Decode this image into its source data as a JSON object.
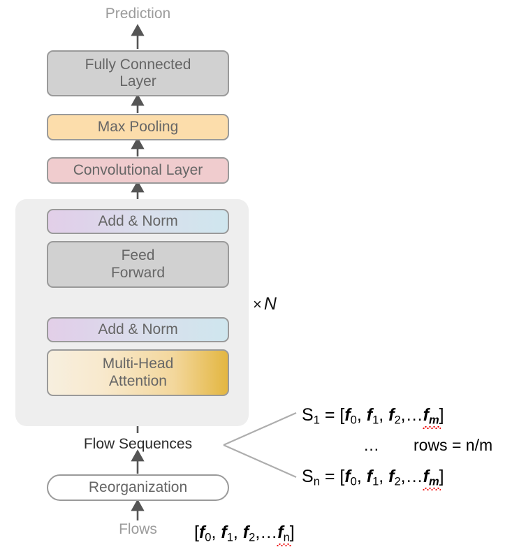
{
  "diagram": {
    "title_text": "Prediction",
    "bottom_label": "Flows",
    "mid_label": "Flow Sequences",
    "repeat_annotation": {
      "times": "×",
      "n": "N"
    }
  },
  "blocks": [
    {
      "id": "fully-connected-layer",
      "label": "Fully Connected\nLayer",
      "line1": "Fully Connected",
      "line2": "Layer",
      "fill": "#d1d1d1"
    },
    {
      "id": "max-pooling",
      "label": "Max Pooling",
      "fill": "#fcddab"
    },
    {
      "id": "convolutional-layer",
      "label": "Convolutional Layer",
      "fill": "#f0ccce"
    },
    {
      "id": "add-norm-top",
      "label": "Add & Norm",
      "fill_from": "#e2cfe8",
      "fill_to": "#cfe6ee"
    },
    {
      "id": "feed-forward",
      "label": "Feed\nForward",
      "line1": "Feed",
      "line2": "Forward",
      "fill": "#d1d1d1"
    },
    {
      "id": "add-norm-bottom",
      "label": "Add & Norm",
      "fill_from": "#e2cfe8",
      "fill_to": "#cfe6ee"
    },
    {
      "id": "multi-head-attention",
      "label": "Multi-Head\nAttention",
      "line1": "Multi-Head",
      "line2": "Attention",
      "fill_from": "#f7efdf",
      "fill_to": "#e3b641"
    },
    {
      "id": "reorganization",
      "label": "Reorganization",
      "fill": "#ffffff"
    }
  ],
  "block_labels": {
    "fully_connected_line1": "Fully Connected",
    "fully_connected_line2": "Layer",
    "max_pooling": "Max Pooling",
    "convolutional_layer": "Convolutional Layer",
    "add_norm_top": "Add & Norm",
    "feed_forward_line1": "Feed",
    "feed_forward_line2": "Forward",
    "add_norm_bottom": "Add & Norm",
    "multi_head_line1": "Multi-Head",
    "multi_head_line2": "Attention",
    "reorganization": "Reorganization"
  },
  "formulas": {
    "s1": {
      "name": "S",
      "name_sub": "1",
      "eq": " = [",
      "items": [
        "f",
        "f",
        "f"
      ],
      "subs": [
        "0",
        "1",
        "2"
      ],
      "ellipsis": ",…",
      "last_var": "f",
      "last_sub": "m",
      "close": "]"
    },
    "sn": {
      "name": "S",
      "name_sub": "n",
      "eq": " = [",
      "items": [
        "f",
        "f",
        "f"
      ],
      "subs": [
        "0",
        "1",
        "2"
      ],
      "ellipsis": ",…",
      "last_var": "f",
      "last_sub": "m",
      "close": "]"
    },
    "dots": "…",
    "rows": "rows = n/m",
    "flows_vector": {
      "open": "[",
      "items": [
        "f",
        "f",
        "f"
      ],
      "subs": [
        "0",
        "1",
        "2"
      ],
      "ellipsis": ",…",
      "last_var": "f",
      "last_sub": "n",
      "close": "]"
    }
  },
  "colors": {
    "panel_bg": "#eeeeee",
    "box_border": "#9a9a9a",
    "box_text": "#666666",
    "arrow": "#555555",
    "branch_line": "#aaaaaa",
    "muted_text": "#9b9b9b",
    "dark_text": "#2b2b2b",
    "squiggle": "#ee0000"
  }
}
